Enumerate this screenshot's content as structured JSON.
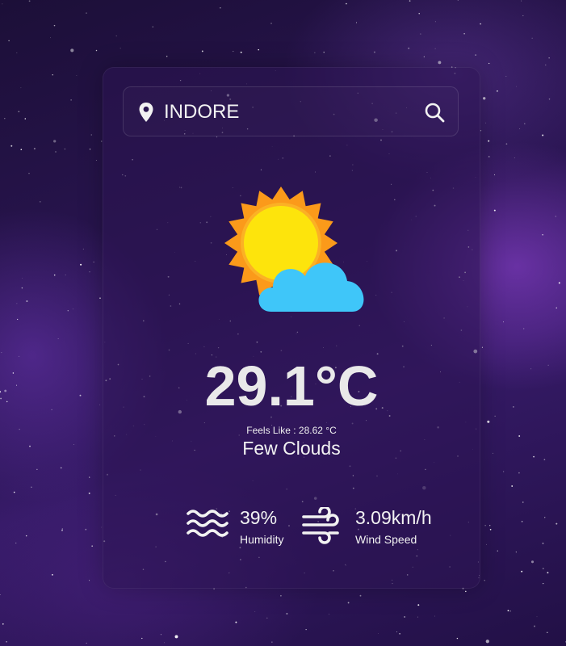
{
  "search": {
    "value": "INDORE",
    "location_icon": "map-pin-icon",
    "search_icon": "search-icon"
  },
  "weather": {
    "icon": "sun-behind-cloud-icon",
    "temperature": "29.1°C",
    "feels_like": "Feels Like : 28.62 °C",
    "description": "Few Clouds"
  },
  "details": {
    "humidity": {
      "icon": "waves-icon",
      "value": "39%",
      "label": "Humidity"
    },
    "wind": {
      "icon": "wind-icon",
      "value": "3.09km/h",
      "label": "Wind Speed"
    }
  },
  "colors": {
    "sun_rays": "#fb9a1a",
    "sun_core": "#fde40c",
    "cloud": "#3fc6f9",
    "text": "#f2f2f2"
  }
}
